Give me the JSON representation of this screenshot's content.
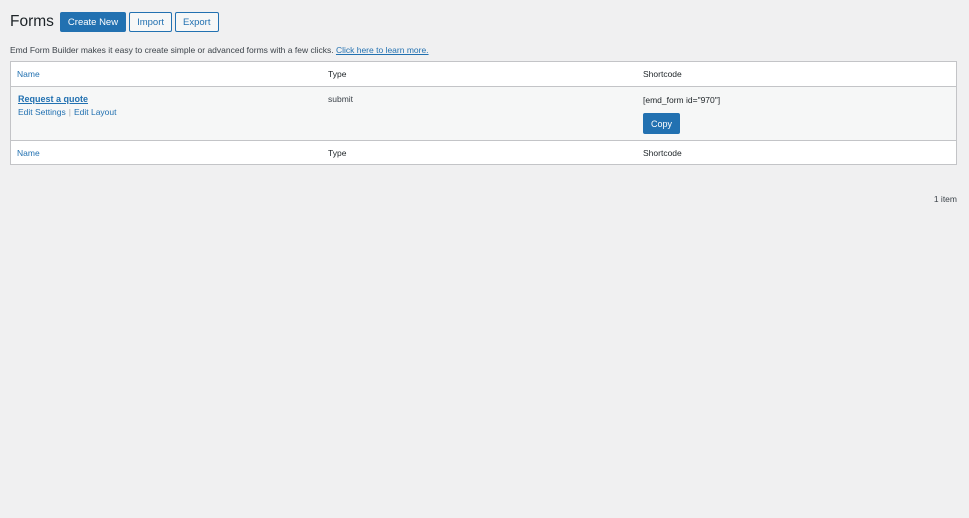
{
  "header": {
    "title": "Forms",
    "create_new": "Create New",
    "import": "Import",
    "export": "Export"
  },
  "intro": {
    "text": "Emd Form Builder makes it easy to create simple or advanced forms with a few clicks. ",
    "link": "Click here to learn more."
  },
  "table": {
    "columns": {
      "name": "Name",
      "type": "Type",
      "shortcode": "Shortcode"
    },
    "rows": [
      {
        "title": "Request a quote",
        "edit_settings": "Edit Settings",
        "separator": "|",
        "edit_layout": "Edit Layout",
        "type": "submit",
        "shortcode": "[emd_form id=\"970\"]",
        "copy": "Copy"
      }
    ]
  },
  "pagination": {
    "count": "1 item"
  },
  "colors": {
    "accent": "#2271b1",
    "background": "#f0f0f1",
    "border": "#c3c4c7"
  }
}
